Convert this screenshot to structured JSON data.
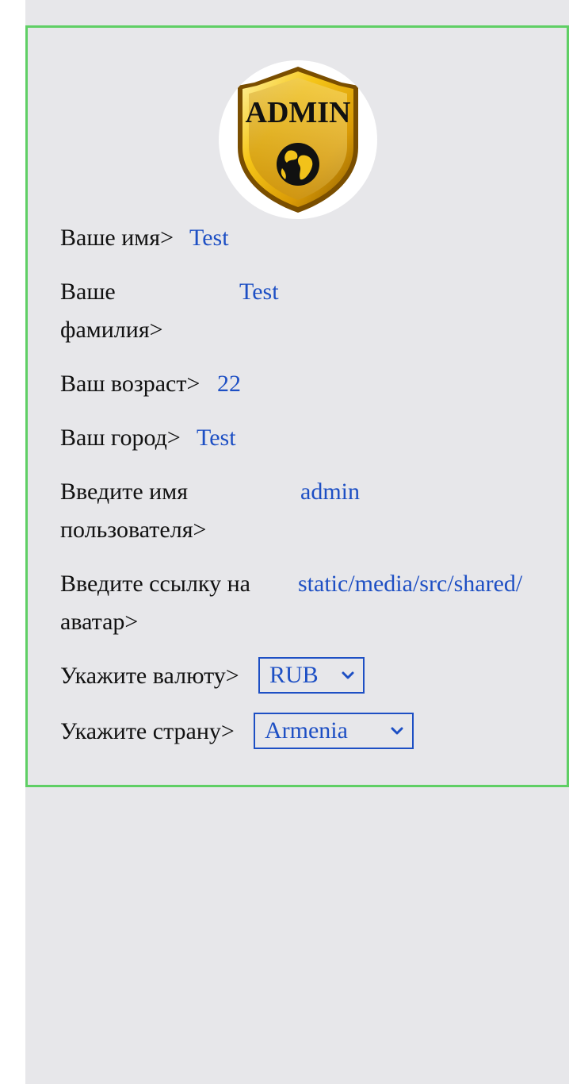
{
  "avatar": {
    "alt": "ADMIN",
    "badge_text": "ADMIN",
    "icon": "admin-shield-globe-icon"
  },
  "fields": {
    "first_name": {
      "label": "Ваше имя>",
      "value": "Test"
    },
    "last_name": {
      "label_line1": "Ваше",
      "label_line2": "фамилия>",
      "value": "Test"
    },
    "age": {
      "label": "Ваш возраст>",
      "value": "22"
    },
    "city": {
      "label": "Ваш город>",
      "value": "Test"
    },
    "username": {
      "label_line1": "Введите имя",
      "label_line2": "пользователя>",
      "value": "admin"
    },
    "avatar_link": {
      "label_line1": "Введите ссылку на",
      "label_line2": "аватар>",
      "value": "static/media/src/shared/"
    },
    "currency": {
      "label": "Укажите валюту>",
      "selected": "RUB",
      "icon": "chevron-down-icon"
    },
    "country": {
      "label": "Укажите страну>",
      "selected": "Armenia",
      "icon": "chevron-down-icon"
    }
  },
  "colors": {
    "card_border": "#5fcf65",
    "background": "#e7e7ea",
    "value_text": "#1d4fc4",
    "label_text": "#111111"
  }
}
